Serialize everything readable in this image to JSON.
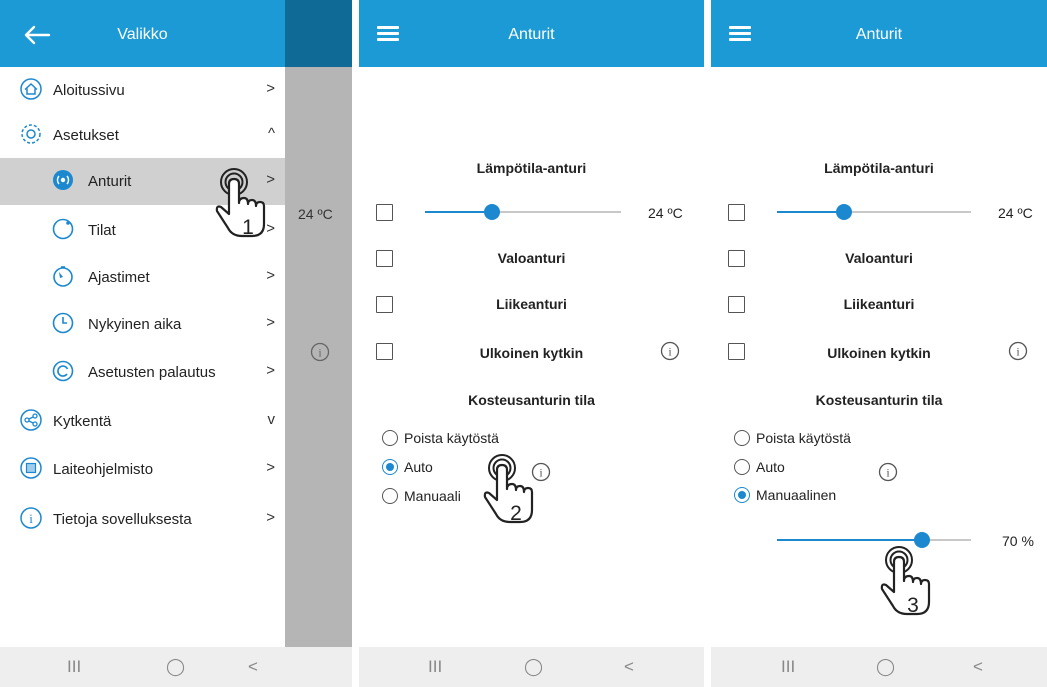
{
  "menu_screen": {
    "title": "Valikko",
    "behind_temp": "24 ºC",
    "items": [
      {
        "label": "Aloitussivu",
        "icon": "home-icon",
        "chevron": ">"
      },
      {
        "label": "Asetukset",
        "icon": "settings-icon",
        "chevron": "^"
      },
      {
        "label": "Anturit",
        "icon": "sensor-icon",
        "chevron": ">",
        "selected": true
      },
      {
        "label": "Tilat",
        "icon": "circle-icon",
        "chevron": ">"
      },
      {
        "label": "Ajastimet",
        "icon": "timer-icon",
        "chevron": ">"
      },
      {
        "label": "Nykyinen aika",
        "icon": "clock-icon",
        "chevron": ">"
      },
      {
        "label": "Asetusten palautus",
        "icon": "reset-icon",
        "chevron": ">"
      },
      {
        "label": "Kytkentä",
        "icon": "share-icon",
        "chevron": "v"
      },
      {
        "label": "Laiteohjelmisto",
        "icon": "firmware-icon",
        "chevron": ">"
      },
      {
        "label": "Tietoja sovelluksesta",
        "icon": "info-icon",
        "chevron": ">"
      }
    ],
    "step": "1"
  },
  "sensor_screen_a": {
    "title": "Anturit",
    "temp_sensor_label": "Lämpötila-anturi",
    "temp_value": "24 ºC",
    "light_sensor_label": "Valoanturi",
    "motion_sensor_label": "Liikeanturi",
    "external_switch_label": "Ulkoinen kytkin",
    "humidity_mode_label": "Kosteusanturin tila",
    "options": [
      "Poista käytöstä",
      "Auto",
      "Manuaalinen"
    ],
    "visible_manual_label": "Manuaali",
    "selected_option": "Auto",
    "step": "2"
  },
  "sensor_screen_b": {
    "title": "Anturit",
    "temp_sensor_label": "Lämpötila-anturi",
    "temp_value": "24 ºC",
    "light_sensor_label": "Valoanturi",
    "motion_sensor_label": "Liikeanturi",
    "external_switch_label": "Ulkoinen kytkin",
    "humidity_mode_label": "Kosteusanturin tila",
    "options": [
      "Poista käytöstä",
      "Auto",
      "Manuaalinen"
    ],
    "selected_option": "Manuaalinen",
    "humidity_value": "70 %",
    "humidity_level_percent": 70,
    "step": "3"
  },
  "navbar": {
    "recent": "III",
    "home": "◯",
    "back": "<"
  },
  "colors": {
    "header": "#1b9ad6",
    "accent": "#1b88d0",
    "dim": "#b5b5b5"
  }
}
